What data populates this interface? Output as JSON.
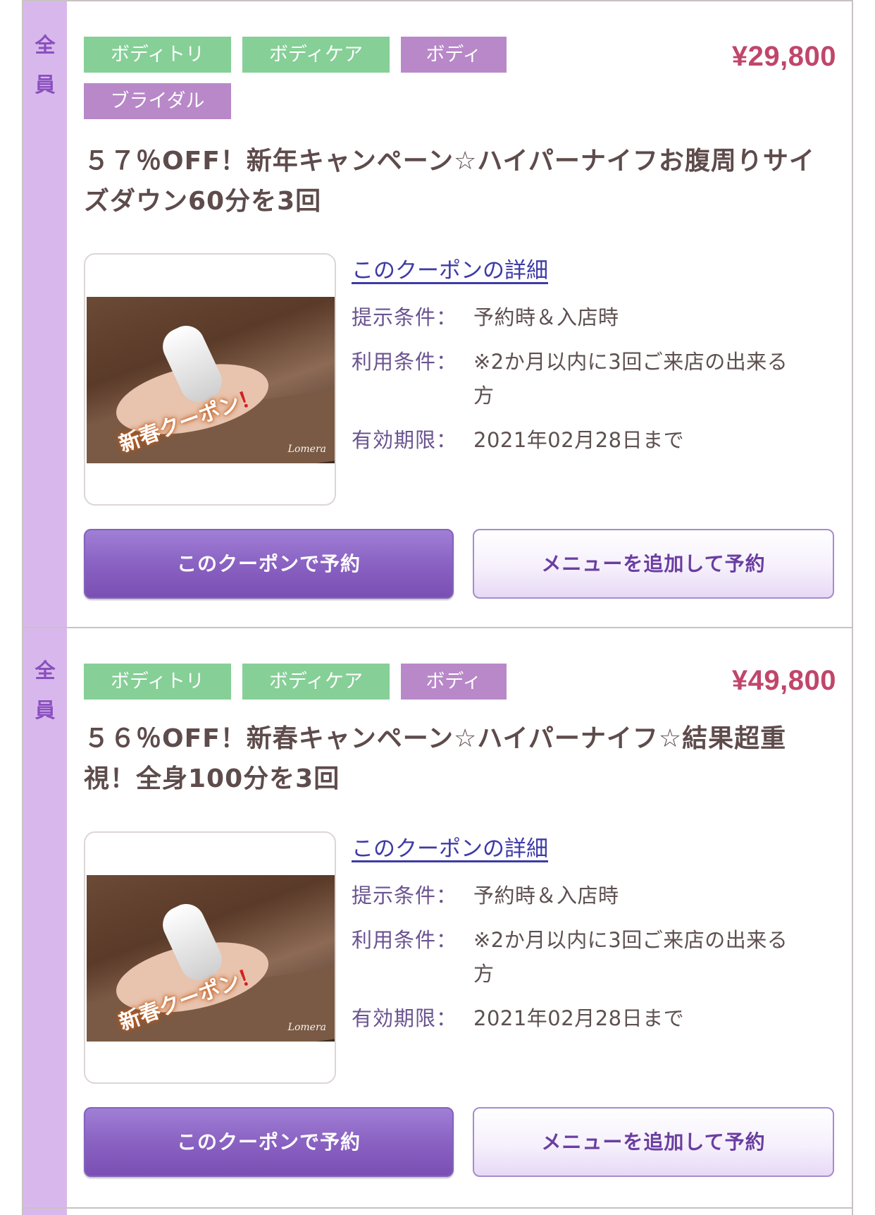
{
  "coupons": [
    {
      "audience": "全\n員",
      "tags": [
        "ボディトリ",
        "ボディケア",
        "ボディ",
        "ブライダル"
      ],
      "price": "¥29,800",
      "title": "５７％OFF！新年キャンペーン☆ハイパーナイフお腹周りサイズダウン60分を3回",
      "image_caption": "新春クーポン",
      "image_mark": "！",
      "image_logo": "Lomera",
      "detail_link": "このクーポンの詳細",
      "details": [
        {
          "label": "提示条件：",
          "value": "予約時＆入店時"
        },
        {
          "label": "利用条件：",
          "value": "※2か月以内に3回ご来店の出来る方"
        },
        {
          "label": "有効期限：",
          "value": "2021年02月28日まで"
        }
      ],
      "book_button": "このクーポンで予約",
      "add_menu_button": "メニューを追加して予約"
    },
    {
      "audience": "全\n員",
      "tags": [
        "ボディトリ",
        "ボディケア",
        "ボディ"
      ],
      "price": "¥49,800",
      "title": "５６％OFF！新春キャンペーン☆ハイパーナイフ☆結果超重視！全身100分を3回",
      "image_caption": "新春クーポン",
      "image_mark": "！",
      "image_logo": "Lomera",
      "detail_link": "このクーポンの詳細",
      "details": [
        {
          "label": "提示条件：",
          "value": "予約時＆入店時"
        },
        {
          "label": "利用条件：",
          "value": "※2か月以内に3回ご来店の出来る方"
        },
        {
          "label": "有効期限：",
          "value": "2021年02月28日まで"
        }
      ],
      "book_button": "このクーポンで予約",
      "add_menu_button": "メニューを追加して予約"
    }
  ],
  "colors": {
    "side_strip": "#d8b8ec",
    "tag_green": "#86cf97",
    "tag_purple": "#b888c8",
    "price": "#c0466a",
    "link": "#3e3aa6",
    "primary_button": "#8a62c2"
  }
}
